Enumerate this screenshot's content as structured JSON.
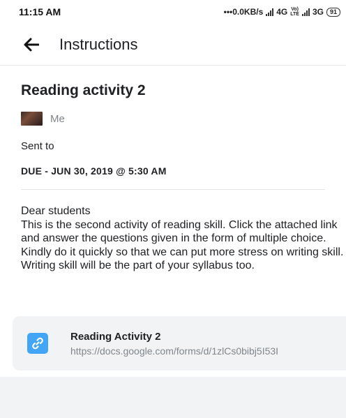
{
  "status_bar": {
    "time": "11:15 AM",
    "network_speed": "•••0.0KB/s",
    "network_1": "4G",
    "volte_top": "Vo)",
    "volte_bottom": "LTE",
    "network_2": "3G",
    "battery": "91"
  },
  "app_bar": {
    "title": "Instructions",
    "back_icon": "arrow-left-icon"
  },
  "assignment": {
    "title": "Reading activity 2",
    "author": "Me",
    "sent_to": "Sent to",
    "due": "DUE - JUN 30, 2019 @ 5:30 AM",
    "body": "Dear students\nThis is the second activity of reading skill. Click the attached link and answer the questions given in the form of multiple choice. Kindly do it quickly so that we can put more stress on writing skill. Writing skill will be the part of your syllabus too."
  },
  "attachment": {
    "icon": "link-icon",
    "title": "Reading Activity 2",
    "url": "https://docs.google.com/forms/d/1zlCs0bibj5I53I"
  },
  "colors": {
    "accent": "#42a5f5",
    "card_bg": "#f1f3f4",
    "secondary_text": "#80868b"
  }
}
